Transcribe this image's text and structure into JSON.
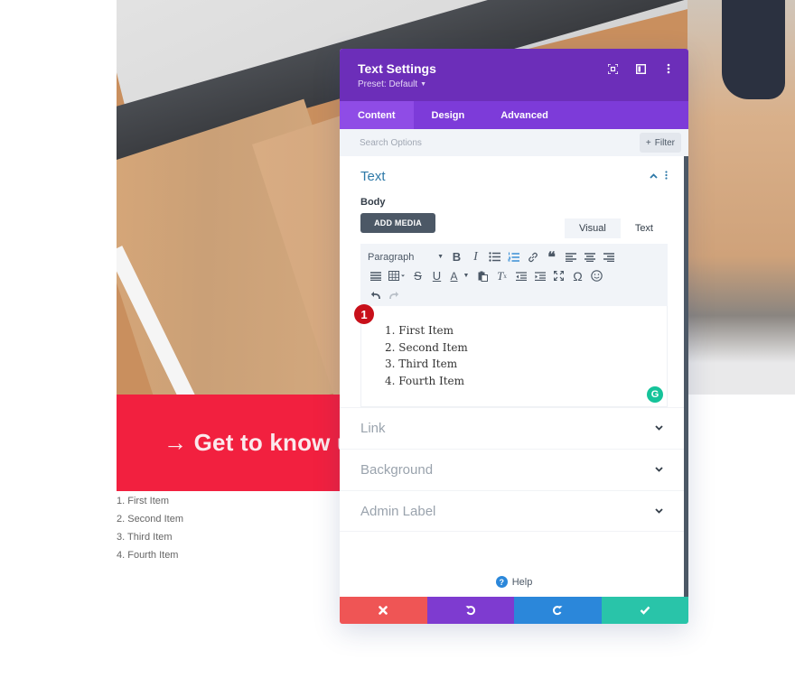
{
  "page": {
    "cta_text": "→ Get to know u",
    "list_items": [
      "1. First Item",
      "2. Second Item",
      "3. Third Item",
      "4. Fourth Item"
    ]
  },
  "modal": {
    "title": "Text Settings",
    "preset": "Preset: Default",
    "tabs": [
      {
        "label": "Content",
        "active": true
      },
      {
        "label": "Design",
        "active": false
      },
      {
        "label": "Advanced",
        "active": false
      }
    ],
    "search": {
      "placeholder": "Search Options",
      "value": ""
    },
    "filter_label": "Filter",
    "text_section": {
      "title": "Text",
      "body_label": "Body",
      "add_media_label": "ADD MEDIA",
      "editor_tabs": [
        {
          "label": "Visual",
          "active": true
        },
        {
          "label": "Text",
          "active": false
        }
      ],
      "format_select": "Paragraph",
      "badge_number": "1",
      "content_items": [
        "First Item",
        "Second Item",
        "Third Item",
        "Fourth Item"
      ]
    },
    "closed_sections": [
      "Link",
      "Background",
      "Admin Label"
    ],
    "help_label": "Help"
  },
  "colors": {
    "header": "#6c2eb9",
    "tabs_bar": "#7d3bd9",
    "cancel": "#ef5555",
    "undo": "#7e3bd0",
    "redo": "#2b87da",
    "save": "#29c4a9",
    "cta": "#f2203f"
  }
}
